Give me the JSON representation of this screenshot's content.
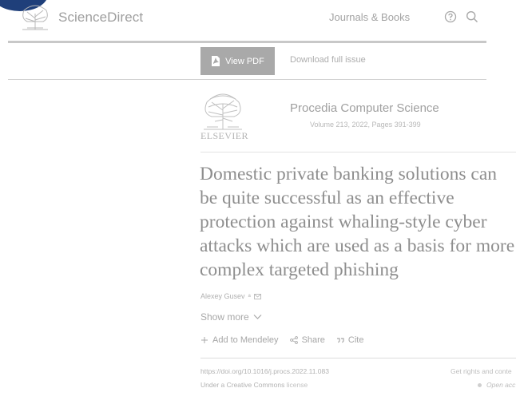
{
  "header": {
    "brand": "ScienceDirect",
    "nav_journals": "Journals & Books",
    "icons": [
      "help-icon",
      "search-icon"
    ]
  },
  "toolbar": {
    "view_pdf": "View PDF",
    "download_issue": "Download full issue"
  },
  "journal": {
    "publisher_word": "ELSEVIER",
    "title": "Procedia Computer Science",
    "meta": "Volume 213, 2022, Pages 391-399"
  },
  "article": {
    "title": "Domestic private banking solutions can be quite successful as an effective protection against whaling-style cyber attacks which are used as a basis for more complex targeted phishing",
    "author": "Alexey Gusev",
    "author_mark": "a",
    "show_more": "Show more",
    "actions": {
      "mendeley": "Add to Mendeley",
      "share": "Share",
      "cite": "Cite"
    },
    "doi": "https://doi.org/10.1016/j.procs.2022.11.083",
    "license_prefix": "Under a Creative Commons",
    "license_suffix": "license",
    "rights": "Get rights and conte",
    "open_access": "Open acc"
  },
  "colors": {
    "header_blob": "#1f3f7a",
    "pdf_button": "#a9a9a9"
  }
}
